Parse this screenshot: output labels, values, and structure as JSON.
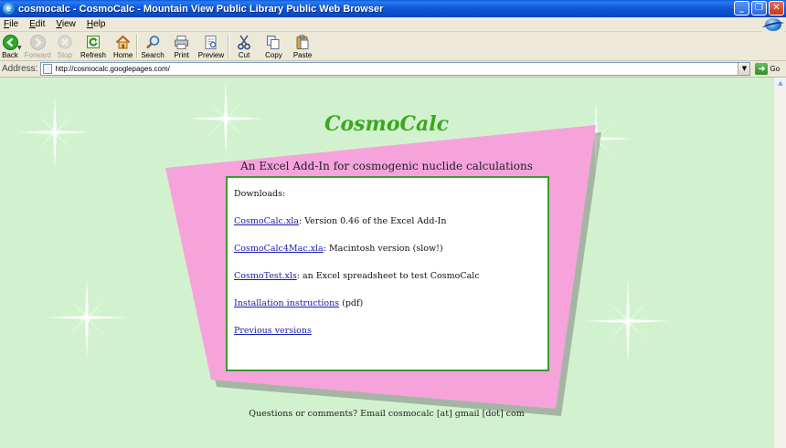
{
  "window": {
    "title": "cosmocalc - CosmoCalc - Mountain View Public Library Public Web Browser",
    "app_glyph": "e"
  },
  "menu": {
    "items": [
      "File",
      "Edit",
      "View",
      "Help"
    ]
  },
  "toolbar": {
    "back": "Back",
    "forward": "Forward",
    "stop": "Stop",
    "refresh": "Refresh",
    "home": "Home",
    "search": "Search",
    "print": "Print",
    "preview": "Preview",
    "cut": "Cut",
    "copy": "Copy",
    "paste": "Paste"
  },
  "address": {
    "label": "Address:",
    "url": "http://cosmocalc.googlepages.com/",
    "go_label": "Go"
  },
  "page": {
    "title": "CosmoCalc",
    "subtitle": "An Excel Add-In for cosmogenic nuclide calculations",
    "downloads_heading": "Downloads:",
    "items": [
      {
        "link": "CosmoCalc.xla",
        "text": ": Version 0.46 of the Excel Add-In"
      },
      {
        "link": "CosmoCalc4Mac.xla",
        "text": ": Macintosh version (slow!)"
      },
      {
        "link": "CosmoTest.xls",
        "text": ": an Excel spreadsheet to test CosmoCalc"
      },
      {
        "link": "Installation instructions",
        "text": " (pdf)"
      },
      {
        "link": "Previous versions",
        "text": ""
      }
    ],
    "footer": "Questions or comments? Email cosmocalc [at] gmail [dot] com"
  },
  "colors": {
    "background": "#d2f2cf",
    "panel_pink": "#f6a3dc",
    "title_green": "#3ba81e",
    "box_border": "#3c9a2c",
    "link": "#1a1ab0"
  }
}
